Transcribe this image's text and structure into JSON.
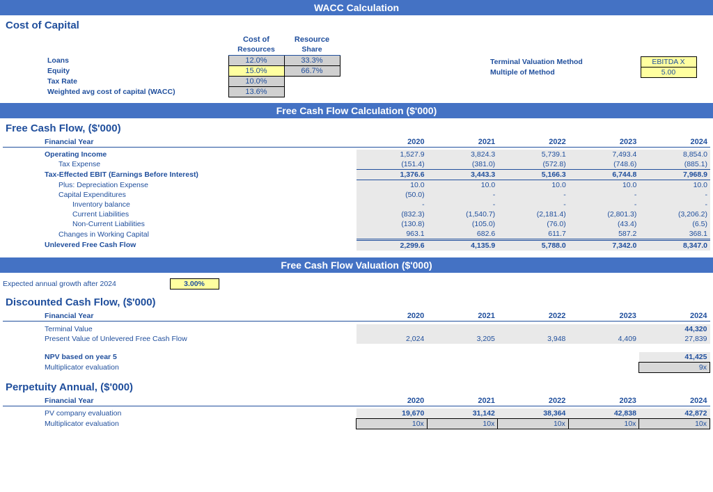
{
  "banners": {
    "wacc": "WACC Calculation",
    "fcf": "Free Cash Flow Calculation ($'000)",
    "fcv": "Free Cash Flow Valuation ($'000)"
  },
  "sections": {
    "costOfCapital": "Cost of Capital",
    "fcfTitle": "Free Cash Flow, ($'000)",
    "dcfTitle": "Discounted Cash Flow, ($'000)",
    "perpTitle": "Perpetuity Annual, ($'000)"
  },
  "coc": {
    "hdr_cost": "Cost of",
    "hdr_cost2": "Resources",
    "hdr_share": "Resource",
    "hdr_share2": "Share",
    "rows": {
      "loans": {
        "label": "Loans",
        "cost": "12.0%",
        "share": "33.3%"
      },
      "equity": {
        "label": "Equity",
        "cost": "15.0%",
        "share": "66.7%"
      },
      "tax": {
        "label": "Tax Rate",
        "val": "10.0%"
      },
      "wacc": {
        "label": "Weighted avg cost of capital (WACC)",
        "val": "13.6%"
      }
    },
    "tvm_label": "Terminal Valuation Method",
    "tvm_val": "EBITDA X",
    "mm_label": "Multiple of Method",
    "mm_val": "5.00"
  },
  "years": [
    "2020",
    "2021",
    "2022",
    "2023",
    "2024"
  ],
  "fy_label": "Financial Year",
  "fcf": {
    "op_income": {
      "label": "Operating Income",
      "vals": [
        "1,527.9",
        "3,824.3",
        "5,739.1",
        "7,493.4",
        "8,854.0"
      ]
    },
    "tax_exp": {
      "label": "Tax Expense",
      "vals": [
        "(151.4)",
        "(381.0)",
        "(572.8)",
        "(748.6)",
        "(885.1)"
      ]
    },
    "tax_ebit": {
      "label": "Tax-Effected EBIT (Earnings Before Interest)",
      "vals": [
        "1,376.6",
        "3,443.3",
        "5,166.3",
        "6,744.8",
        "7,968.9"
      ]
    },
    "dep": {
      "label": "Plus: Depreciation Expense",
      "vals": [
        "10.0",
        "10.0",
        "10.0",
        "10.0",
        "10.0"
      ]
    },
    "capex": {
      "label": "Capital Expenditures",
      "vals": [
        "(50.0)",
        "-",
        "-",
        "-",
        "-"
      ]
    },
    "inv": {
      "label": "Inventory balance",
      "vals": [
        "-",
        "-",
        "-",
        "-",
        "-"
      ]
    },
    "cl": {
      "label": "Current Liabilities",
      "vals": [
        "(832.3)",
        "(1,540.7)",
        "(2,181.4)",
        "(2,801.3)",
        "(3,206.2)"
      ]
    },
    "ncl": {
      "label": "Non-Current Liabilities",
      "vals": [
        "(130.8)",
        "(105.0)",
        "(76.0)",
        "(43.4)",
        "(6.5)"
      ]
    },
    "wc": {
      "label": "Changes in Working Capital",
      "vals": [
        "963.1",
        "682.6",
        "611.7",
        "587.2",
        "368.1"
      ]
    },
    "ufcf": {
      "label": "Unlevered Free Cash Flow",
      "vals": [
        "2,299.6",
        "4,135.9",
        "5,788.0",
        "7,342.0",
        "8,347.0"
      ]
    }
  },
  "growth": {
    "label": "Expected annual growth after 2024",
    "val": "3.00%"
  },
  "dcf": {
    "term_val": {
      "label": "Terminal Value",
      "vals": [
        "",
        "",
        "",
        "",
        "44,320"
      ]
    },
    "pv_ufcf": {
      "label": "Present Value of Unlevered Free Cash Flow",
      "vals": [
        "2,024",
        "3,205",
        "3,948",
        "4,409",
        "27,839"
      ]
    },
    "npv": {
      "label": "NPV based on year 5",
      "val": "41,425"
    },
    "mult": {
      "label": "Multiplicator evaluation",
      "val": "9x"
    }
  },
  "perp": {
    "pv": {
      "label": "PV company evaluation",
      "vals": [
        "19,670",
        "31,142",
        "38,364",
        "42,838",
        "42,872"
      ]
    },
    "mult": {
      "label": "Multiplicator evaluation",
      "vals": [
        "10x",
        "10x",
        "10x",
        "10x",
        "10x"
      ]
    }
  }
}
